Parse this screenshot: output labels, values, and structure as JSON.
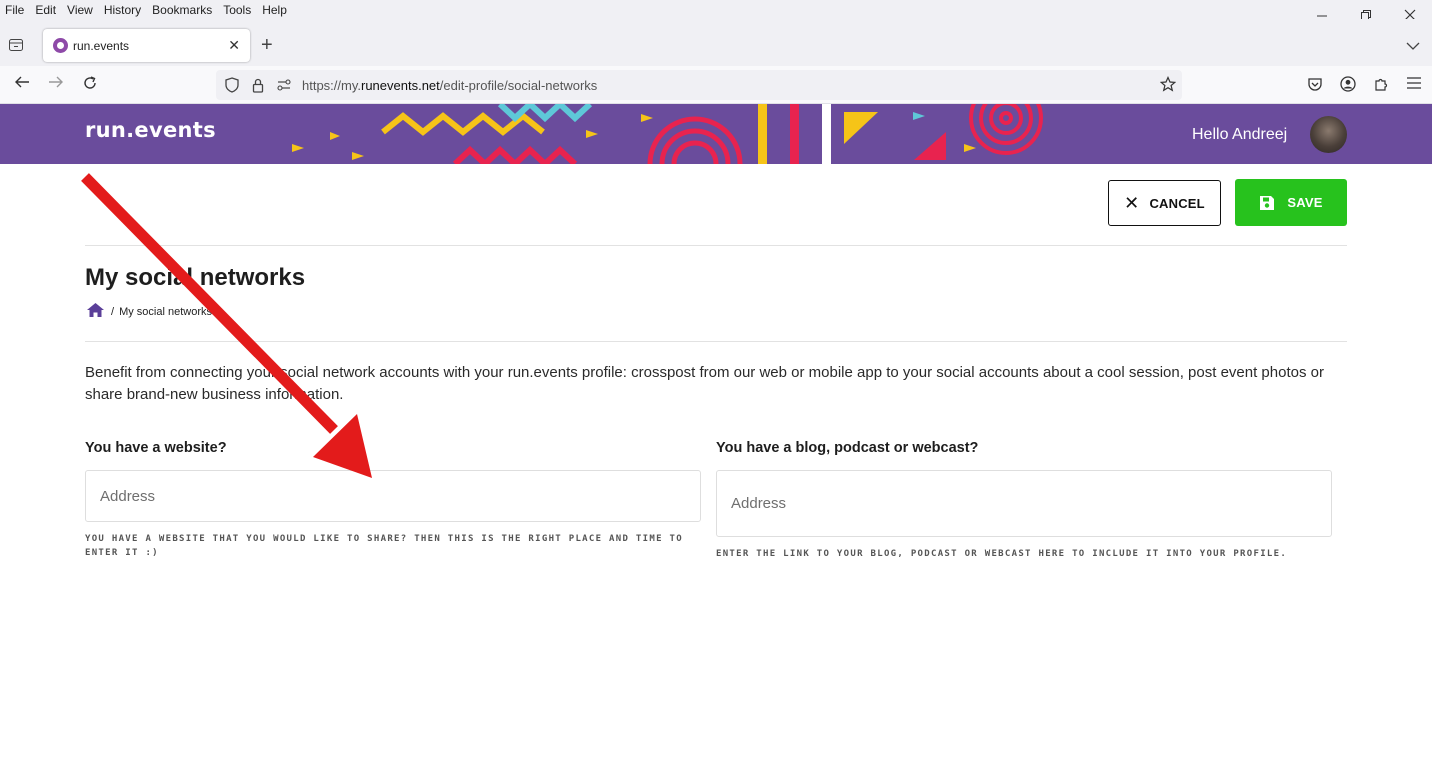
{
  "browser": {
    "menu": [
      "File",
      "Edit",
      "View",
      "History",
      "Bookmarks",
      "Tools",
      "Help"
    ],
    "tab": {
      "title": "run.events"
    },
    "url": {
      "prefix": "https://my.",
      "domain": "runevents.net",
      "path": "/edit-profile/social-networks"
    }
  },
  "header": {
    "logo": "run.events",
    "greeting": "Hello Andreej"
  },
  "toolbar": {
    "cancel_label": "CANCEL",
    "save_label": "SAVE"
  },
  "page": {
    "title": "My social networks",
    "breadcrumb": {
      "current": "My social networks"
    },
    "intro": "Benefit from connecting your social network accounts with your run.events profile: crosspost from our web or mobile app to your social accounts about a cool session, post event photos or share brand-new business information."
  },
  "fields": {
    "website": {
      "label": "You have a website?",
      "placeholder": "Address",
      "help": "YOU HAVE A WEBSITE THAT YOU WOULD LIKE TO SHARE? THEN THIS IS THE RIGHT PLACE AND TIME TO ENTER IT :)"
    },
    "blog": {
      "label": "You have a blog, podcast or webcast?",
      "placeholder": "Address",
      "help": "ENTER THE LINK TO YOUR BLOG, PODCAST OR WEBCAST HERE TO INCLUDE IT INTO YOUR PROFILE."
    }
  },
  "colors": {
    "header_purple": "#6a4c9c",
    "save_green": "#27c21d",
    "annotation_red": "#e31b1b"
  }
}
